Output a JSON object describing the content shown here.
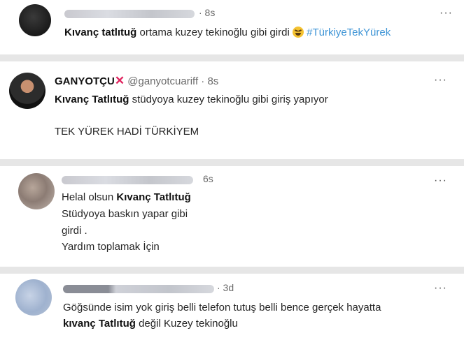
{
  "tweet1": {
    "time": "· 8s",
    "name": "Kıvanç tatlıtuğ",
    "text": " ortama kuzey tekinoğlu gibi girdi ",
    "hashtag": "#TürkiyeTekYürek",
    "more": "···"
  },
  "tweet2": {
    "display_name": "GANYOTÇU",
    "handle": "@ganyotcuariff",
    "time": "· 8s",
    "more": "···",
    "line1_name": "Kıvanç Tatlıtuğ",
    "line1_text": " stüdyoya kuzey tekinoğlu gibi giriş yapıyor",
    "line2": "TEK YÜREK HADİ TÜRKİYEM"
  },
  "tweet3": {
    "time": "6s",
    "more": "···",
    "line1_text": "Helal olsun ",
    "line1_name": "Kıvanç Tatlıtuğ",
    "line2": "Stüdyoya baskın yapar gibi",
    "line3": "girdi .",
    "line4": "Yardım toplamak İçin"
  },
  "tweet4": {
    "time": "· 3d",
    "more": "···",
    "line1": "Göğsünde isim yok giriş belli telefon tutuş belli bence gerçek hayatta",
    "line2_name": "kıvanç Tatlıtuğ",
    "line2_text": " değil Kuzey tekinoğlu"
  }
}
